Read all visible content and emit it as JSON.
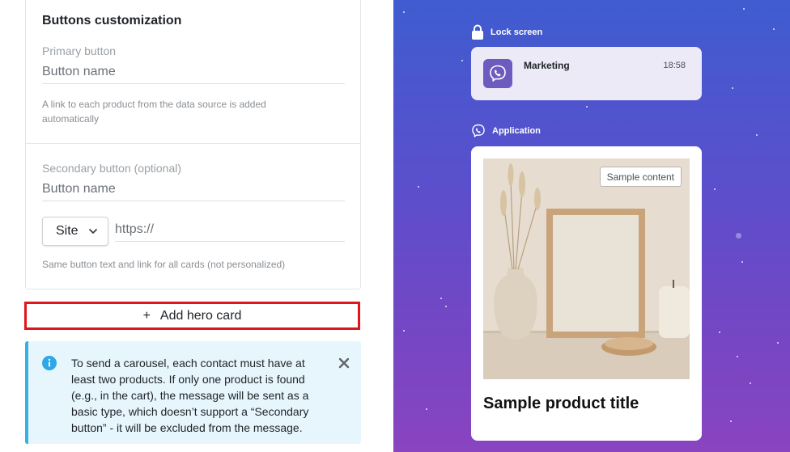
{
  "buttons_section": {
    "title": "Buttons customization",
    "primary": {
      "label": "Primary button",
      "placeholder": "Button name",
      "hint": "A link to each product from the data source is added automatically"
    },
    "secondary": {
      "label": "Secondary button (optional)",
      "placeholder": "Button name",
      "link_type": "Site",
      "url_placeholder": "https://",
      "hint": "Same button text and link for all cards (not personalized)"
    }
  },
  "add_hero_card": {
    "label": "Add hero card",
    "icon": "plus-icon"
  },
  "info_notice": {
    "text": "To send a carousel, each contact must have at least two products. If only one product is found (e.g., in the cart), the message will be sent as a basic type, which doesn’t support a “Secondary button” - it will be excluded from the message.",
    "icon": "info-icon",
    "accent_color": "#33b0e6"
  },
  "preview": {
    "lock_screen": {
      "header": "Lock screen",
      "sender": "Marketing",
      "time": "18:58",
      "icon": "viber-icon"
    },
    "application": {
      "header": "Application",
      "badge": "Sample content",
      "product_title": "Sample product title"
    }
  },
  "colors": {
    "highlight": "#e0161c",
    "preview_bg_top": "#3f5cd0",
    "preview_bg_bottom": "#8a44c0",
    "viber_purple": "#6d5bc0"
  }
}
